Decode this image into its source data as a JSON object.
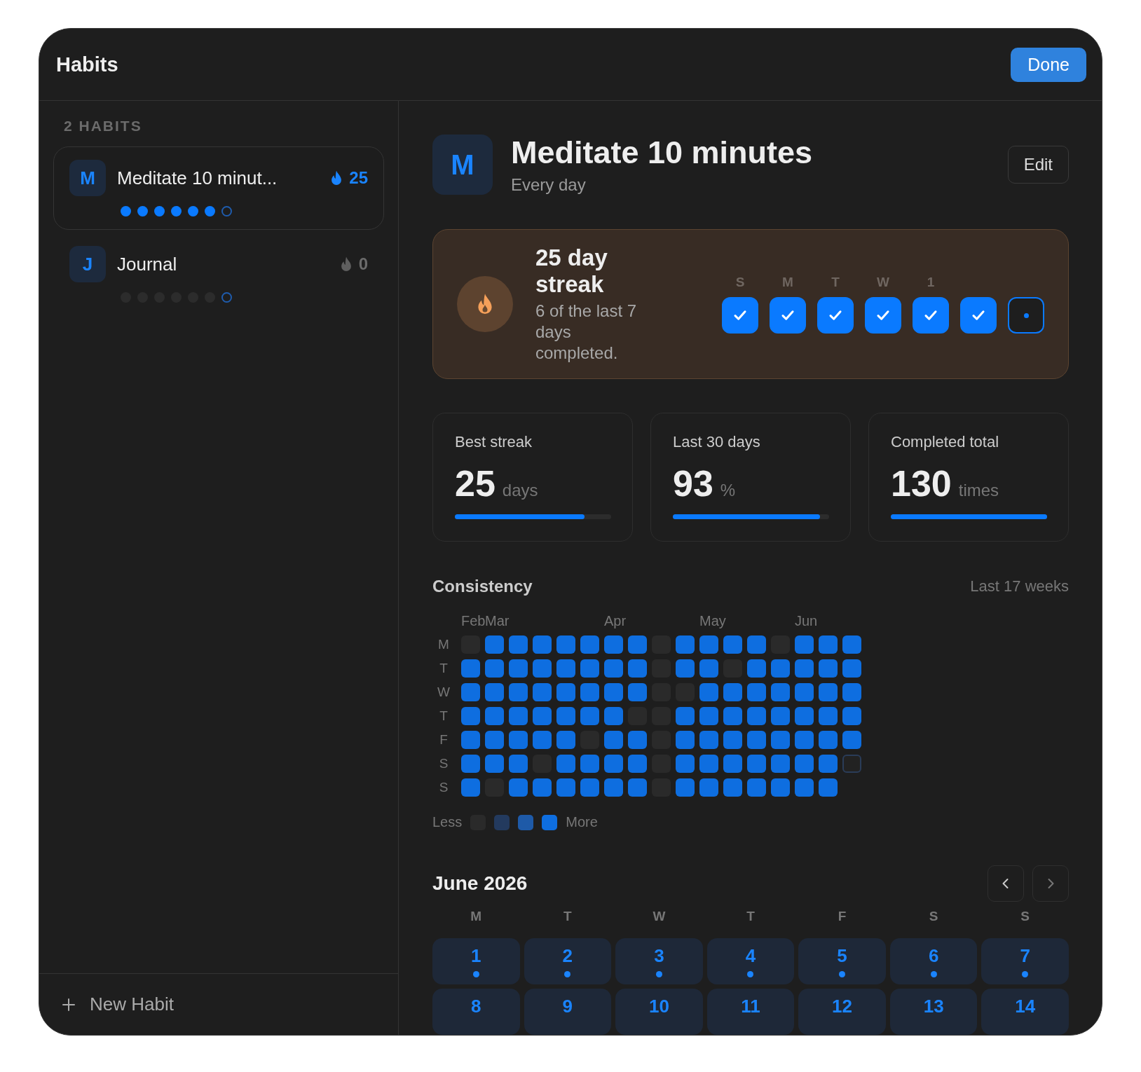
{
  "window": {
    "title": "Habits",
    "done_button": "Done"
  },
  "sidebar": {
    "heading": "2 HABITS",
    "items": [
      {
        "initial": "M",
        "name": "Meditate 10 minut...",
        "streak": "25",
        "streak_active": true,
        "selected": true,
        "week": [
          {
            "done": true,
            "today": false
          },
          {
            "done": true,
            "today": false
          },
          {
            "done": true,
            "today": false
          },
          {
            "done": true,
            "today": false
          },
          {
            "done": true,
            "today": false
          },
          {
            "done": true,
            "today": false
          },
          {
            "done": false,
            "today": true
          }
        ]
      },
      {
        "initial": "J",
        "name": "Journal",
        "streak": "0",
        "streak_active": false,
        "selected": false,
        "week": [
          {
            "done": false,
            "today": false
          },
          {
            "done": false,
            "today": false
          },
          {
            "done": false,
            "today": false
          },
          {
            "done": false,
            "today": false
          },
          {
            "done": false,
            "today": false
          },
          {
            "done": false,
            "today": false
          },
          {
            "done": false,
            "today": true
          }
        ]
      }
    ],
    "new_button": "New Habit"
  },
  "detail": {
    "initial": "M",
    "title": "Meditate 10 minutes",
    "schedule": "Every day",
    "edit_button": "Edit",
    "streak_card": {
      "title": "25 day streak",
      "subtitle": "6 of the last 7 days completed.",
      "days": [
        {
          "label": "S",
          "done": true,
          "today": false
        },
        {
          "label": "M",
          "done": true,
          "today": false
        },
        {
          "label": "T",
          "done": true,
          "today": false
        },
        {
          "label": "W",
          "done": true,
          "today": false
        },
        {
          "label": "1",
          "done": true,
          "today": false
        },
        {
          "done": true,
          "today": false
        },
        {
          "done": false,
          "today": true
        }
      ]
    },
    "stats": [
      {
        "label": "Best streak",
        "value": "25",
        "unit": "days",
        "level": 0.83
      },
      {
        "label": "Last 30 days",
        "value": "93",
        "unit": "%",
        "level": 0.94
      },
      {
        "label": "Completed total",
        "value": "130",
        "unit": "times",
        "level": 1.0
      }
    ],
    "consistency": {
      "title": "Consistency",
      "range": "Last 17 weeks",
      "day_labels": [
        "M",
        "T",
        "W",
        "T",
        "F",
        "S",
        "S"
      ],
      "weeks": [
        {
          "month": "Feb",
          "days": [
            {
              "done": false
            },
            {
              "done": true
            },
            {
              "done": true
            },
            {
              "done": true
            },
            {
              "done": true
            },
            {
              "done": true
            },
            {
              "done": true
            }
          ]
        },
        {
          "month": "Mar",
          "days": [
            {
              "done": true
            },
            {
              "done": true
            },
            {
              "done": true
            },
            {
              "done": true
            },
            {
              "done": true
            },
            {
              "done": true
            },
            {
              "done": false
            }
          ]
        },
        {
          "days": [
            {
              "done": true
            },
            {
              "done": true
            },
            {
              "done": true
            },
            {
              "done": true
            },
            {
              "done": true
            },
            {
              "done": true
            },
            {
              "done": true
            }
          ]
        },
        {
          "days": [
            {
              "done": true
            },
            {
              "done": true
            },
            {
              "done": true
            },
            {
              "done": true
            },
            {
              "done": true
            },
            {
              "done": false
            },
            {
              "done": true
            }
          ]
        },
        {
          "days": [
            {
              "done": true
            },
            {
              "done": true
            },
            {
              "done": true
            },
            {
              "done": true
            },
            {
              "done": true
            },
            {
              "done": true
            },
            {
              "done": true
            }
          ]
        },
        {
          "days": [
            {
              "done": true
            },
            {
              "done": true
            },
            {
              "done": true
            },
            {
              "done": true
            },
            {
              "done": false
            },
            {
              "done": true
            },
            {
              "done": true
            }
          ]
        },
        {
          "month": "Apr",
          "days": [
            {
              "done": true
            },
            {
              "done": true
            },
            {
              "done": true
            },
            {
              "done": true
            },
            {
              "done": true
            },
            {
              "done": true
            },
            {
              "done": true
            }
          ]
        },
        {
          "days": [
            {
              "done": true
            },
            {
              "done": true
            },
            {
              "done": true
            },
            {
              "done": false
            },
            {
              "done": true
            },
            {
              "done": true
            },
            {
              "done": true
            }
          ]
        },
        {
          "days": [
            {
              "done": false
            },
            {
              "done": false
            },
            {
              "done": false
            },
            {
              "done": false
            },
            {
              "done": false
            },
            {
              "done": false
            },
            {
              "done": false
            }
          ]
        },
        {
          "days": [
            {
              "done": true
            },
            {
              "done": true
            },
            {
              "done": false
            },
            {
              "done": true
            },
            {
              "done": true
            },
            {
              "done": true
            },
            {
              "done": true
            }
          ]
        },
        {
          "month": "May",
          "days": [
            {
              "done": true
            },
            {
              "done": true
            },
            {
              "done": true
            },
            {
              "done": true
            },
            {
              "done": true
            },
            {
              "done": true
            },
            {
              "done": true
            }
          ]
        },
        {
          "days": [
            {
              "done": true
            },
            {
              "done": false
            },
            {
              "done": true
            },
            {
              "done": true
            },
            {
              "done": true
            },
            {
              "done": true
            },
            {
              "done": true
            }
          ]
        },
        {
          "days": [
            {
              "done": true
            },
            {
              "done": true
            },
            {
              "done": true
            },
            {
              "done": true
            },
            {
              "done": true
            },
            {
              "done": true
            },
            {
              "done": true
            }
          ]
        },
        {
          "days": [
            {
              "done": false
            },
            {
              "done": true
            },
            {
              "done": true
            },
            {
              "done": true
            },
            {
              "done": true
            },
            {
              "done": true
            },
            {
              "done": true
            }
          ]
        },
        {
          "month": "Jun",
          "days": [
            {
              "done": true
            },
            {
              "done": true
            },
            {
              "done": true
            },
            {
              "done": true
            },
            {
              "done": true
            },
            {
              "done": true
            },
            {
              "done": true
            }
          ]
        },
        {
          "days": [
            {
              "done": true
            },
            {
              "done": true
            },
            {
              "done": true
            },
            {
              "done": true
            },
            {
              "done": true
            },
            {
              "done": true
            },
            {
              "done": true
            }
          ]
        },
        {
          "days": [
            {
              "done": true
            },
            {
              "done": true
            },
            {
              "done": true
            },
            {
              "done": true
            },
            {
              "done": true
            },
            {
              "done": false,
              "today": true
            }
          ]
        }
      ],
      "legend_less": "Less",
      "legend_more": "More"
    },
    "calendar": {
      "title": "June 2026",
      "weekdays": [
        "M",
        "T",
        "W",
        "T",
        "F",
        "S",
        "S"
      ],
      "days": [
        {
          "label": "1",
          "done": true
        },
        {
          "label": "2",
          "done": true
        },
        {
          "label": "3",
          "done": true
        },
        {
          "label": "4",
          "done": true
        },
        {
          "label": "5",
          "done": true
        },
        {
          "label": "6",
          "done": true
        },
        {
          "label": "7",
          "done": true
        },
        {
          "label": "8",
          "done": false
        },
        {
          "label": "9",
          "done": false
        },
        {
          "label": "10",
          "done": false
        },
        {
          "label": "11",
          "done": false
        },
        {
          "label": "12",
          "done": false
        },
        {
          "label": "13",
          "done": false
        },
        {
          "label": "14",
          "done": false
        }
      ]
    }
  }
}
